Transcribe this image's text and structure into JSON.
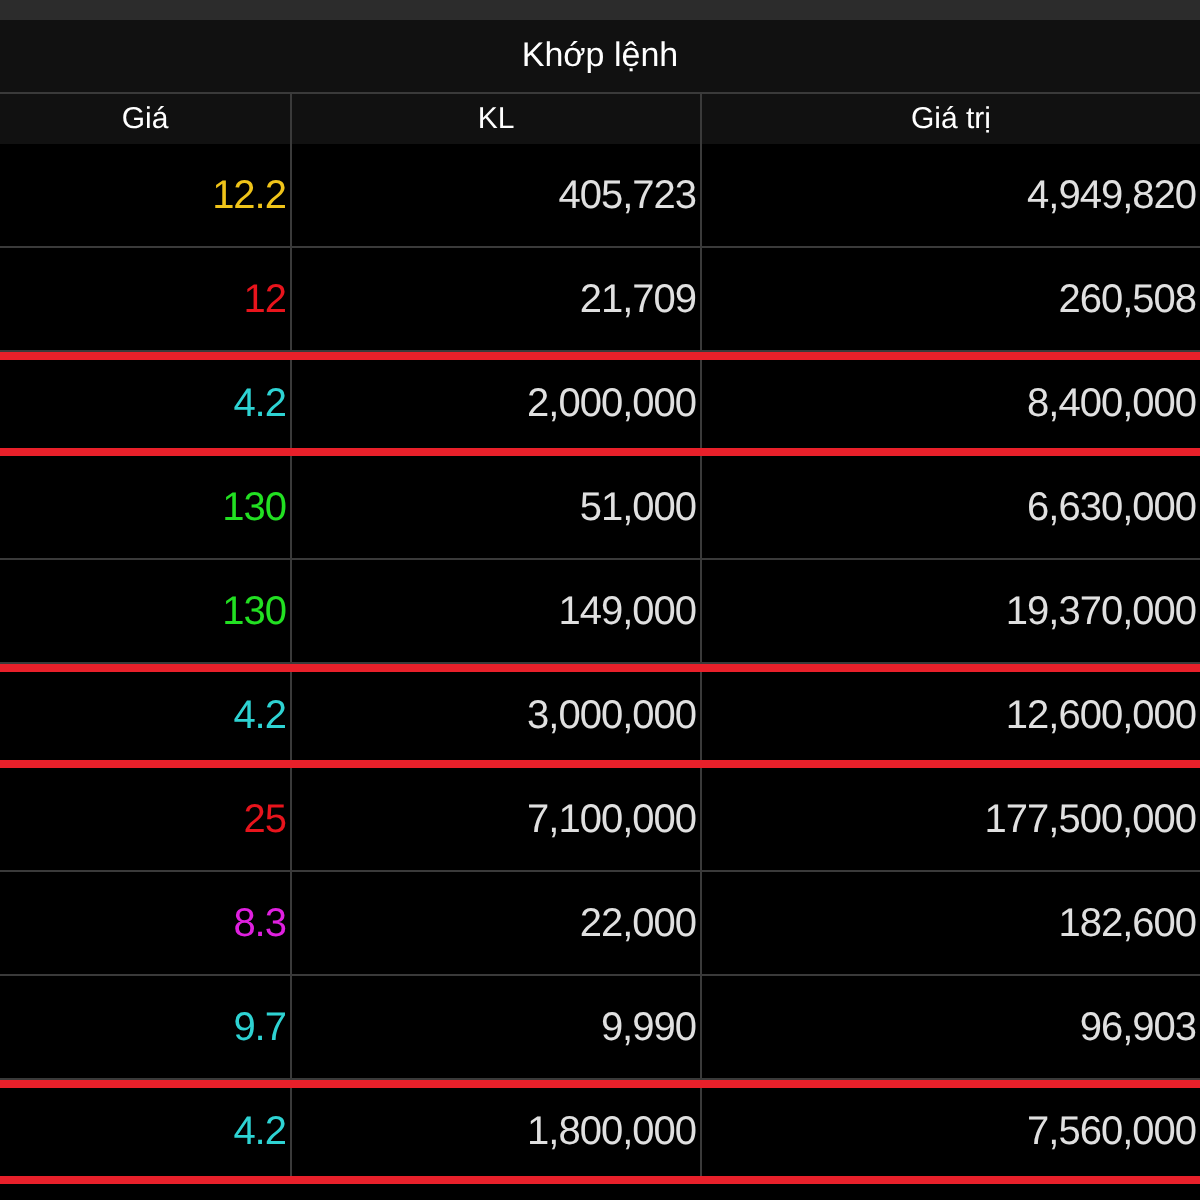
{
  "title": "Khớp lệnh",
  "columns": [
    "Giá",
    "KL",
    "Giá trị"
  ],
  "rows": [
    {
      "price": "12.2",
      "color": "#f0c419",
      "volume": "405,723",
      "value": "4,949,820",
      "selected": false
    },
    {
      "price": "12",
      "color": "#e8141c",
      "volume": "21,709",
      "value": "260,508",
      "selected": false
    },
    {
      "price": "4.2",
      "color": "#2ed3d3",
      "volume": "2,000,000",
      "value": "8,400,000",
      "selected": true
    },
    {
      "price": "130",
      "color": "#22e022",
      "volume": "51,000",
      "value": "6,630,000",
      "selected": false
    },
    {
      "price": "130",
      "color": "#22e022",
      "volume": "149,000",
      "value": "19,370,000",
      "selected": false
    },
    {
      "price": "4.2",
      "color": "#2ed3d3",
      "volume": "3,000,000",
      "value": "12,600,000",
      "selected": true
    },
    {
      "price": "25",
      "color": "#e8141c",
      "volume": "7,100,000",
      "value": "177,500,000",
      "selected": false
    },
    {
      "price": "8.3",
      "color": "#e020e0",
      "volume": "22,000",
      "value": "182,600",
      "selected": false
    },
    {
      "price": "9.7",
      "color": "#2ed3d3",
      "volume": "9,990",
      "value": "96,903",
      "selected": false
    },
    {
      "price": "4.2",
      "color": "#2ed3d3",
      "volume": "1,800,000",
      "value": "7,560,000",
      "selected": true
    }
  ]
}
